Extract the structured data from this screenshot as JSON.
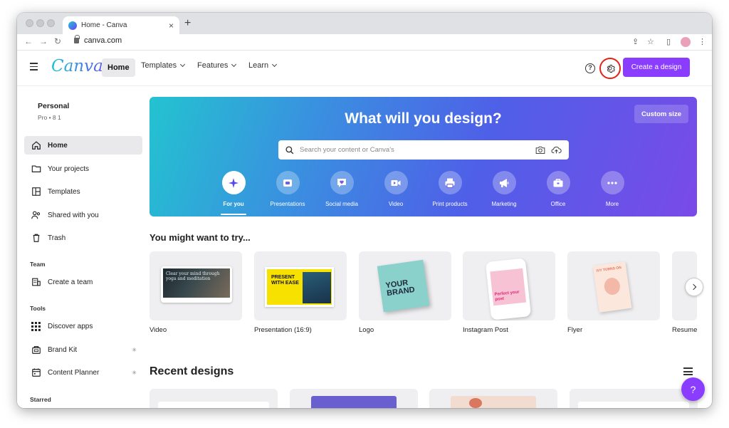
{
  "browser": {
    "tab_title": "Home - Canva",
    "tab_close": "×",
    "new_tab": "+",
    "url": "canva.com",
    "back": "←",
    "forward": "→",
    "reload": "↻",
    "share": "⇪",
    "bookmark": "☆",
    "sidebar_toggle": "▯",
    "menu": "⋮"
  },
  "header": {
    "logo": "Canva",
    "nav": [
      {
        "label": "Home",
        "active": true
      },
      {
        "label": "Templates"
      },
      {
        "label": "Features"
      },
      {
        "label": "Learn"
      }
    ],
    "help": "?",
    "create_label": "Create a design",
    "accent_color": "#8b3dff",
    "highlight_ring_color": "#e2231a"
  },
  "sidebar": {
    "account_name": "Personal",
    "account_sub": "Pro • 8 1",
    "items": [
      {
        "label": "Home",
        "icon": "home-icon",
        "active": true
      },
      {
        "label": "Your projects",
        "icon": "folder-icon"
      },
      {
        "label": "Templates",
        "icon": "templates-icon"
      },
      {
        "label": "Shared with you",
        "icon": "shared-icon"
      },
      {
        "label": "Trash",
        "icon": "trash-icon"
      }
    ],
    "team_heading": "Team",
    "team_items": [
      {
        "label": "Create a team",
        "icon": "building-icon"
      }
    ],
    "tools_heading": "Tools",
    "tools_items": [
      {
        "label": "Discover apps",
        "icon": "apps-grid-icon"
      },
      {
        "label": "Brand Kit",
        "icon": "brand-kit-icon",
        "pin": "✳"
      },
      {
        "label": "Content Planner",
        "icon": "calendar-icon",
        "pin": "✳"
      }
    ],
    "starred_heading": "Starred"
  },
  "hero": {
    "title": "What will you design?",
    "custom_size": "Custom size",
    "search_placeholder": "Search your content or Canva's",
    "categories": [
      {
        "label": "For you",
        "icon": "sparkle-icon",
        "active": true
      },
      {
        "label": "Presentations",
        "icon": "presentation-icon"
      },
      {
        "label": "Social media",
        "icon": "heart-chat-icon"
      },
      {
        "label": "Video",
        "icon": "video-icon"
      },
      {
        "label": "Print products",
        "icon": "printer-icon"
      },
      {
        "label": "Marketing",
        "icon": "megaphone-icon"
      },
      {
        "label": "Office",
        "icon": "briefcase-icon"
      },
      {
        "label": "More",
        "icon": "more-dots-icon"
      }
    ]
  },
  "try_section": {
    "title": "You might want to try...",
    "cards": [
      {
        "label": "Video",
        "thumb_text": "Clear your mind through yoga and meditation"
      },
      {
        "label": "Presentation (16:9)",
        "thumb_text": "PRESENT WITH EASE"
      },
      {
        "label": "Logo",
        "thumb_text": "YOUR BRAND"
      },
      {
        "label": "Instagram Post",
        "thumb_text": "Perfect your post"
      },
      {
        "label": "Flyer",
        "thumb_text": "IVY TURNS ON"
      },
      {
        "label": "Resume",
        "thumb_text": ""
      }
    ]
  },
  "recent_section": {
    "title": "Recent designs"
  },
  "fab_label": "?"
}
